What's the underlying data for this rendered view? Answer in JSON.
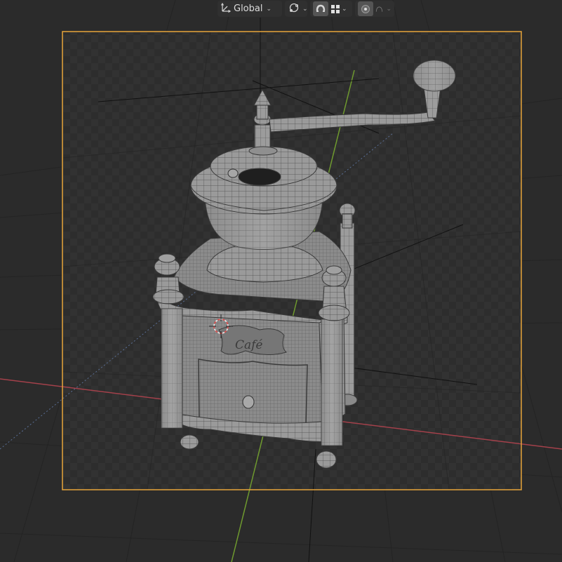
{
  "header": {
    "orientation": {
      "value": "Global",
      "icon": "transform-orientation-icon"
    },
    "pivot": {
      "icon": "pivot-point-icon"
    },
    "snap": {
      "magnet_icon": "snap-magnet-icon",
      "target_icon": "snap-grid-icon"
    },
    "proportional": {
      "toggle_icon": "proportional-editing-icon",
      "falloff_icon": "falloff-curve-icon"
    }
  },
  "scene": {
    "object": "coffee-grinder",
    "label_text": "Café",
    "colors": {
      "viewport_bg": "#2b2b2b",
      "camera_frame": "#e8a53a",
      "x_axis": "#b04650",
      "y_axis": "#6f9a2f",
      "mesh_fill": "#8e8e8e",
      "wire": "#2e2e2e"
    }
  }
}
